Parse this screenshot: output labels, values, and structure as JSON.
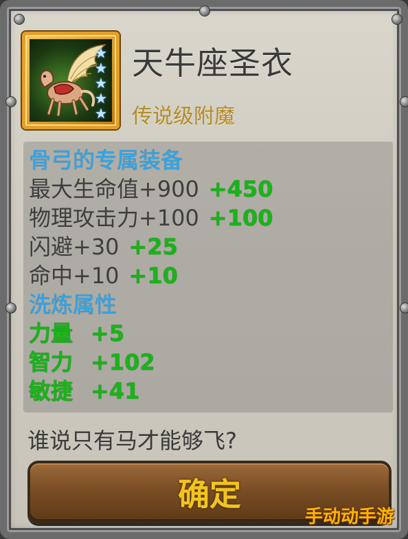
{
  "item": {
    "name": "天牛座圣衣",
    "quality": "传说级附魔",
    "stars": 5,
    "icon": "winged-pegasus-icon"
  },
  "stats": {
    "exclusive_header": "骨弓的专属装备",
    "base": [
      {
        "label": "最大生命值+900",
        "bonus": "+450"
      },
      {
        "label": "物理攻击力+100",
        "bonus": "+100"
      },
      {
        "label": "闪避+30",
        "bonus": "+25"
      },
      {
        "label": "命中+10",
        "bonus": "+10"
      }
    ],
    "refine_header": "洗炼属性",
    "refine": [
      {
        "label": "力量",
        "bonus": "+5"
      },
      {
        "label": "智力",
        "bonus": "+102"
      },
      {
        "label": "敏捷",
        "bonus": "+41"
      }
    ]
  },
  "description": "谁说只有马才能够飞?",
  "confirm_label": "确定",
  "watermark": "手动动手游",
  "colors": {
    "header_blue": "#2aa8f0",
    "bonus_green": "#18b418",
    "quality_gold": "#b08c2a",
    "button_text": "#f3c421"
  }
}
